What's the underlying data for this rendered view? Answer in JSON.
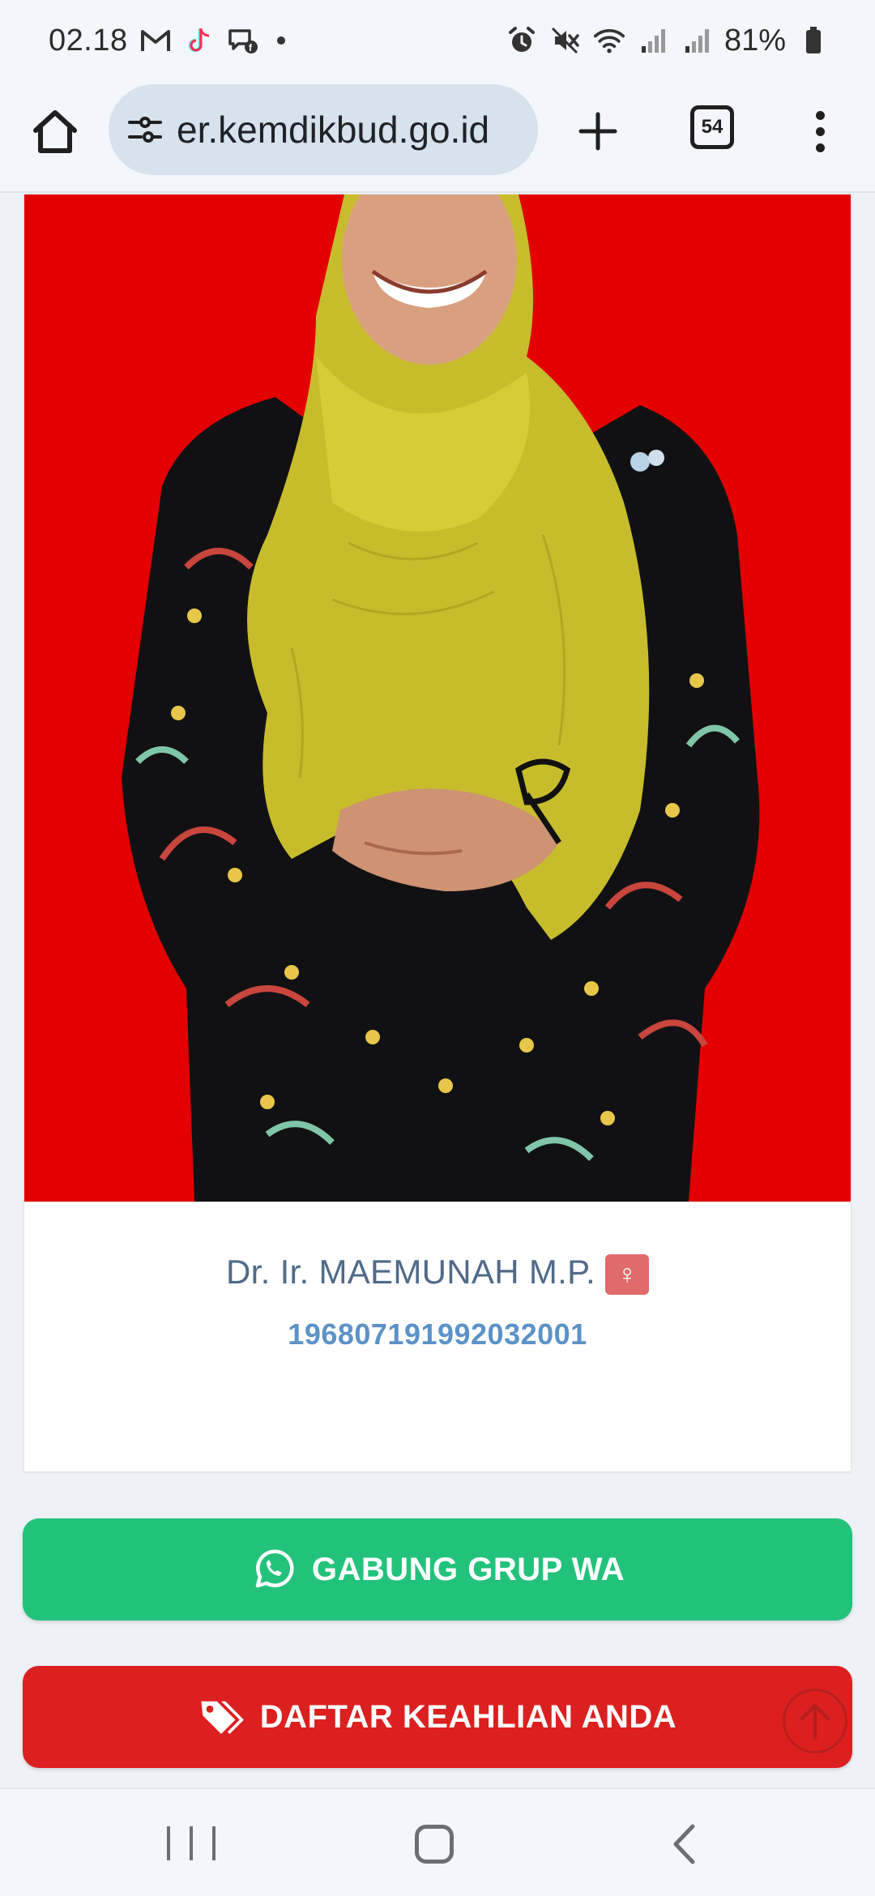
{
  "status_bar": {
    "time": "02.18",
    "battery_percent": "81%",
    "notification_icons": [
      "gmail-icon",
      "tiktok-icon",
      "messenger-icon",
      "dot-icon"
    ],
    "system_icons": [
      "alarm-icon",
      "mute-icon",
      "wifi-icon",
      "signal-icon",
      "signal-icon",
      "battery-icon"
    ]
  },
  "browser": {
    "url": "er.kemdikbud.go.id",
    "tab_count": "54"
  },
  "profile": {
    "name": "Dr. Ir. MAEMUNAH M.P.",
    "gender_symbol": "♀",
    "nip": "196807191992032001"
  },
  "actions": {
    "whatsapp_label": "GABUNG GRUP WA",
    "daftar_label": "DAFTAR KEAHLIAN ANDA"
  },
  "colors": {
    "photo_background": "#e30000",
    "wa_button": "#22c27a",
    "daftar_button": "#dc1f1f",
    "name_text": "#4f6b8a",
    "nip_text": "#5b92c7",
    "gender_badge": "#e06b6b"
  }
}
